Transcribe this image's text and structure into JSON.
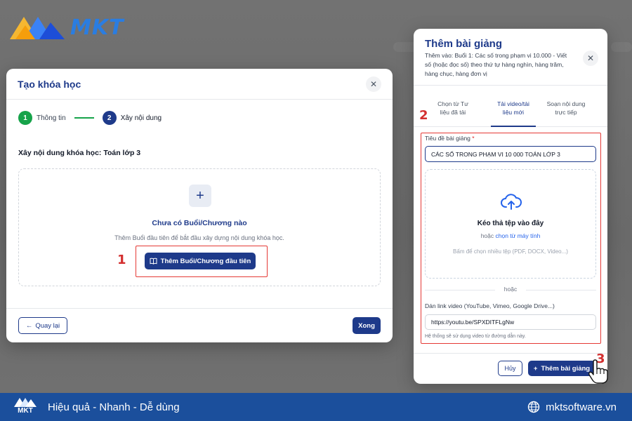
{
  "brand": {
    "logo_text": "MKT",
    "slogan": "Hiệu quả - Nhanh - Dễ dùng",
    "website": "mktsoftware.vn",
    "accent": "#1e3a8a",
    "bar_color": "#1b4f9c"
  },
  "create_course": {
    "title": "Tạo khóa học",
    "steps": [
      {
        "num": "1",
        "label": "Thông tin"
      },
      {
        "num": "2",
        "label": "Xây nội dung"
      }
    ],
    "subtitle": "Xây nội dung khóa học: Toán lớp 3",
    "empty_title": "Chưa có Buổi/Chương nào",
    "empty_desc": "Thêm Buổi đầu tiên để bắt đầu xây dựng nội dung khóa học.",
    "add_first_label": "Thêm Buổi/Chương đầu tiên",
    "back_label": "Quay lại",
    "done_label": "Xong"
  },
  "add_lecture": {
    "title": "Thêm bài giảng",
    "subtitle": "Thêm vào: Buổi 1: Các số trong phạm vi 10.000 - Viết số (hoặc đọc số) theo thứ tự hàng nghìn, hàng trăm, hàng chục, hàng đơn vị",
    "tabs": [
      {
        "line1": "Chọn từ Tư",
        "line2": "liệu đã tải"
      },
      {
        "line1": "Tải video/tài",
        "line2": "liệu mới"
      },
      {
        "line1": "Soạn nội dung",
        "line2": "trực tiếp"
      }
    ],
    "title_label": "Tiêu đề bài giảng",
    "title_required": "*",
    "title_value": "CÁC SỐ TRONG PHẠM VI 10 000 TOÁN LỚP 3",
    "drop_title": "Kéo thả tệp vào đây",
    "drop_or": "hoặc",
    "drop_link": "chọn từ máy tính",
    "drop_hint": "Bấm để chọn nhiều tệp (PDF, DOCX, Video...)",
    "or_label": "hoặc",
    "video_label": "Dán link video (YouTube, Vimeo, Google Drive...)",
    "video_value": "https://youtu.be/SPXDITFLgNw",
    "video_hint": "Hệ thống sẽ sử dụng video từ đường dẫn này.",
    "cancel_label": "Hủy",
    "submit_label": "Thêm bài giảng"
  },
  "annotations": {
    "n1": "1",
    "n2": "2",
    "n3": "3"
  }
}
